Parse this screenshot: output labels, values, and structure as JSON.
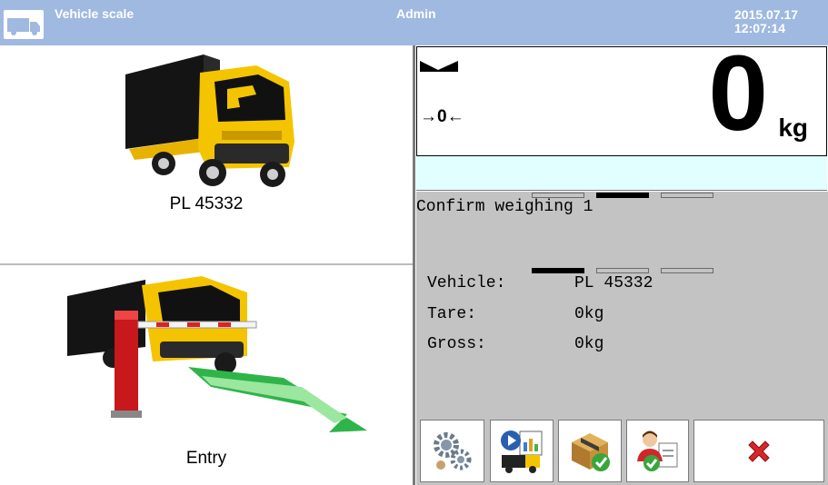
{
  "header": {
    "app_icon": "truck-icon",
    "title": "Vehicle scale",
    "user": "Admin",
    "date": "2015.07.17",
    "time": "12:07:14"
  },
  "vehicle_panel": {
    "plate": "PL 45332",
    "image": "yellow-truck-image"
  },
  "entry_panel": {
    "label": "Entry",
    "image": "truck-barrier-entry-image"
  },
  "scale": {
    "weight": "0",
    "unit": "kg",
    "stable_indicator": "stable-indicator-icon",
    "zero_indicator": "→0←",
    "message": ""
  },
  "process": {
    "step_title": "Confirm weighing 1",
    "step_progress": {
      "total": 3,
      "active_index": 2
    },
    "field_progress": {
      "total": 3,
      "active_index": 1
    },
    "fields": [
      {
        "label": "Vehicle:",
        "value": "PL 45332"
      },
      {
        "label": "Tare:",
        "value": "0kg"
      },
      {
        "label": "Gross:",
        "value": "0kg"
      }
    ]
  },
  "buttons": [
    {
      "name": "settings-button",
      "icon": "gears-icon"
    },
    {
      "name": "reports-button",
      "icon": "report-truck-icon"
    },
    {
      "name": "products-button",
      "icon": "package-check-icon"
    },
    {
      "name": "operators-button",
      "icon": "user-check-icon"
    },
    {
      "name": "cancel-button",
      "icon": "red-x-icon"
    }
  ],
  "colors": {
    "header_bg": "#9fb9e0",
    "message_bg": "#e1ffff",
    "process_bg": "#c3c3c3",
    "cancel_red": "#d7262a",
    "truck_yellow": "#f5c400"
  }
}
